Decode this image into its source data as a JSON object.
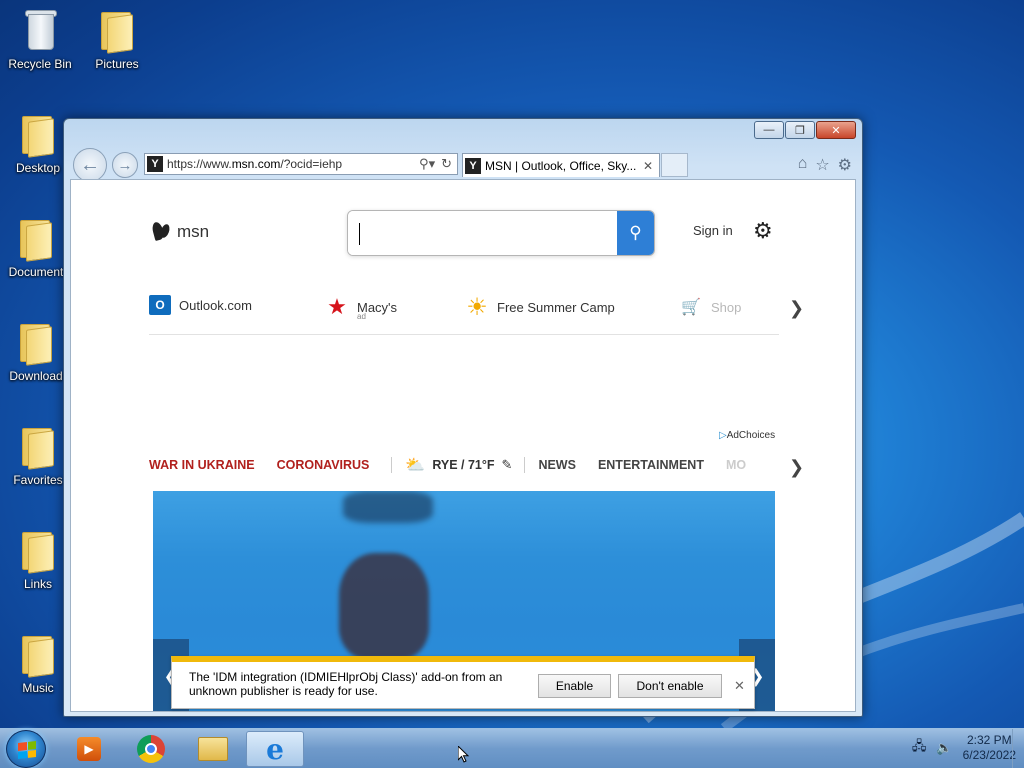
{
  "desktop": {
    "icons": [
      {
        "label": "Recycle Bin"
      },
      {
        "label": "Pictures"
      },
      {
        "label": "Desktop"
      },
      {
        "label": "Document"
      },
      {
        "label": "Download"
      },
      {
        "label": "Favorites"
      },
      {
        "label": "Links"
      },
      {
        "label": "Music"
      }
    ]
  },
  "browser": {
    "address": {
      "prefix": "https://www.",
      "domain": "msn.com",
      "suffix": "/?ocid=iehp"
    },
    "tab": {
      "title": "MSN | Outlook, Office, Sky..."
    },
    "favicon": "Y"
  },
  "msn": {
    "logo_text": "msn",
    "search": {
      "value": "",
      "placeholder": ""
    },
    "sign_in": "Sign in",
    "shortcuts": [
      {
        "label": "Outlook.com",
        "icon": "outlook-icon"
      },
      {
        "label": "Macy's",
        "sub": "ad",
        "icon": "macys-star-icon"
      },
      {
        "label": "Free Summer Camp",
        "icon": "sun-icon"
      },
      {
        "label": "Shop",
        "icon": "cart-icon"
      }
    ],
    "adchoices": "AdChoices",
    "nav": {
      "war": "WAR IN UKRAINE",
      "corona": "CORONAVIRUS",
      "weather": "RYE / 71°F",
      "news": "NEWS",
      "entertainment": "ENTERTAINMENT",
      "more": "MO"
    }
  },
  "notification": {
    "message": "The 'IDM integration (IDMIEHlprObj Class)' add-on from an unknown publisher is ready for use.",
    "enable": "Enable",
    "dont_enable": "Don't enable"
  },
  "taskbar": {
    "time": "2:32 PM",
    "date": "6/23/2022"
  },
  "colors": {
    "accent": "#2e7fd6",
    "alert_red": "#b1201d",
    "notif_bar": "#f0b90b"
  }
}
